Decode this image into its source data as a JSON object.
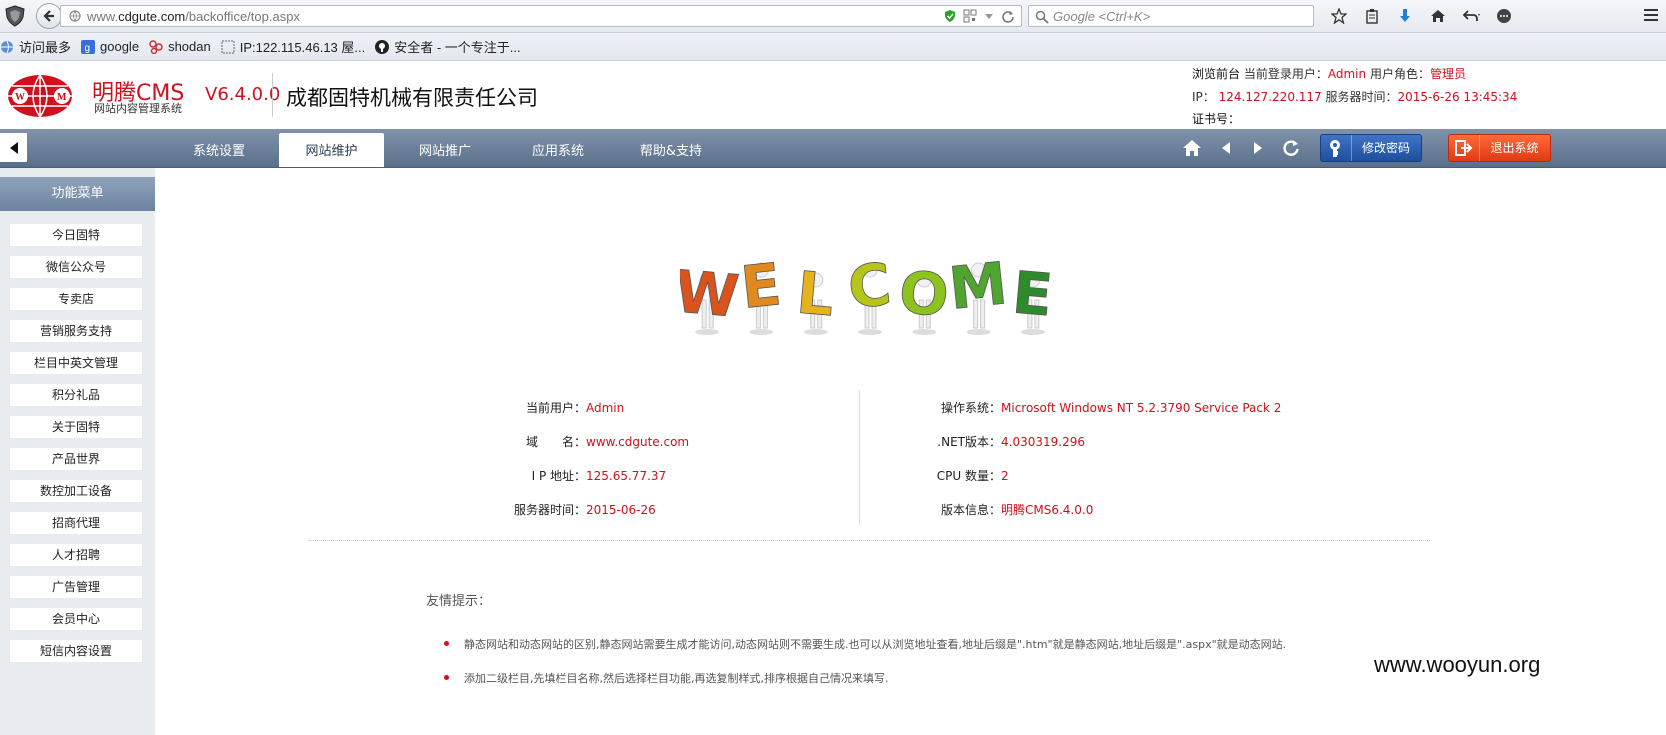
{
  "browser": {
    "url_prefix": "www.",
    "url_domain": "cdgute.com",
    "url_path": "/backoffice/top.aspx",
    "search_placeholder": "Google <Ctrl+K>",
    "bookmarks": [
      {
        "label": "访问最多",
        "icon": "globe-icon"
      },
      {
        "label": "google",
        "icon": "google-icon"
      },
      {
        "label": "shodan",
        "icon": "shodan-icon"
      },
      {
        "label": "IP:122.115.46.13 屋...",
        "icon": "page-icon"
      },
      {
        "label": "安全者 - 一个专注于...",
        "icon": "github-icon"
      }
    ]
  },
  "header": {
    "logo_name": "明腾CMS",
    "logo_sub": "网站内容管理系统",
    "version": "V6.4.0.0",
    "company": "成都固特机械有限责任公司",
    "line1_browse": "浏览前台",
    "line1_user_label": "当前登录用户：",
    "line1_user": "Admin",
    "line1_role_label": "用户角色：",
    "line1_role": "管理员",
    "line2_ip_label": "IP：",
    "line2_ip": "124.127.220.117",
    "line2_time_label": "服务器时间：",
    "line2_time": "2015-6-26 13:45:34",
    "line3_cert_label": "证书号："
  },
  "nav": {
    "tabs": [
      {
        "label": "系统设置"
      },
      {
        "label": "网站维护"
      },
      {
        "label": "网站推广"
      },
      {
        "label": "应用系统"
      },
      {
        "label": "帮助&支持"
      }
    ],
    "active_tab": "网站维护",
    "change_password": "修改密码",
    "logout": "退出系统"
  },
  "sidebar": {
    "title": "功能菜单",
    "items": [
      {
        "label": "今日固特"
      },
      {
        "label": "微信公众号"
      },
      {
        "label": "专卖店"
      },
      {
        "label": "营销服务支持"
      },
      {
        "label": "栏目中英文管理"
      },
      {
        "label": "积分礼品"
      },
      {
        "label": "关于固特"
      },
      {
        "label": "产品世界"
      },
      {
        "label": "数控加工设备"
      },
      {
        "label": "招商代理"
      },
      {
        "label": "人才招聘"
      },
      {
        "label": "广告管理"
      },
      {
        "label": "会员中心"
      },
      {
        "label": "短信内容设置"
      }
    ]
  },
  "main": {
    "welcome_letters": [
      "W",
      "E",
      "L",
      "C",
      "O",
      "M",
      "E"
    ],
    "welcome_colors": [
      "#d9531e",
      "#e08a1e",
      "#e6b21e",
      "#b5c51c",
      "#8dc21f",
      "#4fa52d",
      "#2d8a2d"
    ],
    "left_info": [
      {
        "label": "当前用户：",
        "value": "Admin"
      },
      {
        "label": "域　　名：",
        "value": "www.cdgute.com"
      },
      {
        "label": "I P 地址：",
        "value": "125.65.77.37"
      },
      {
        "label": "服务器时间：",
        "value": "2015-06-26"
      }
    ],
    "right_info": [
      {
        "label": "操作系统：",
        "value": "Microsoft Windows NT 5.2.3790 Service Pack 2"
      },
      {
        "label": ".NET版本：",
        "value": "4.030319.296"
      },
      {
        "label": "CPU 数量：",
        "value": "2"
      },
      {
        "label": "版本信息：",
        "value": "明腾CMS6.4.0.0"
      }
    ],
    "tips_title": "友情提示：",
    "tips": [
      "静态网站和动态网站的区别,静态网站需要生成才能访问,动态网站则不需要生成.也可以从浏览地址查看,地址后缀是\".htm\"就是静态网站,地址后缀是\".aspx\"就是动态网站.",
      "添加二级栏目,先填栏目名称,然后选择栏目功能,再选复制样式,排序根据自己情况来填写."
    ]
  },
  "watermark": "www.wooyun.org",
  "colors": {
    "accent_red": "#d0101e",
    "nav_blue": "#6b809c",
    "button_blue": "#2a5eb0",
    "button_orange": "#f0531f"
  }
}
